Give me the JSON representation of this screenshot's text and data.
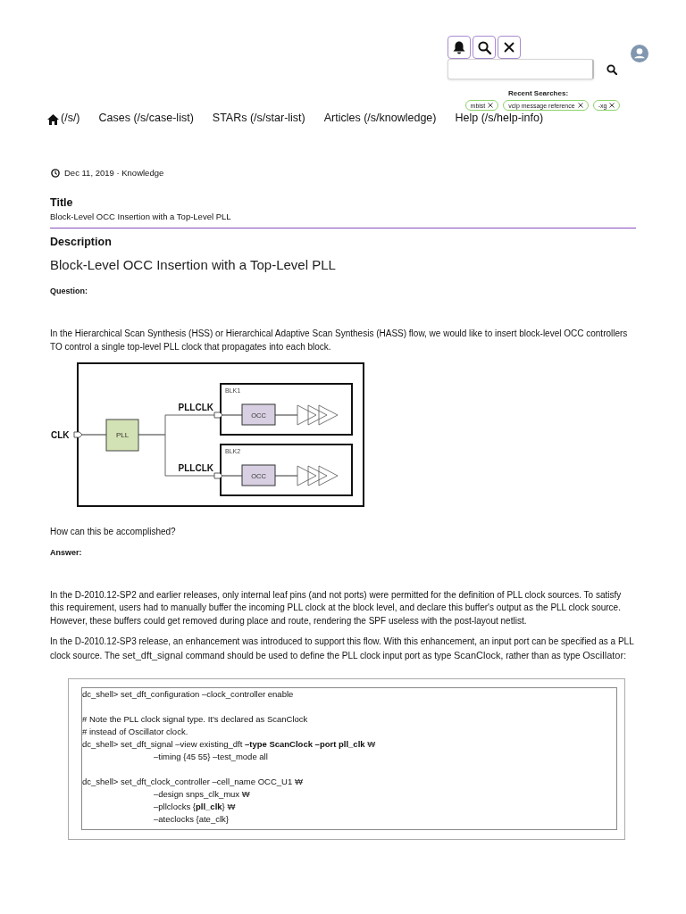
{
  "header": {
    "recent_searches": {
      "label": "Recent Searches:",
      "chips": [
        "mbist",
        "vclp message reference",
        "-xg"
      ]
    }
  },
  "nav": [
    {
      "kind": "home",
      "label": "(/s/)"
    },
    {
      "kind": "link",
      "label": "Cases (/s/case-list)"
    },
    {
      "kind": "link",
      "label": "STARs (/s/star-list)"
    },
    {
      "kind": "link",
      "label": "Articles (/s/knowledge)"
    },
    {
      "kind": "link",
      "label": "Help (/s/help-info)"
    }
  ],
  "meta": "Dec 11, 2019 · Knowledge",
  "title_section": {
    "heading": "Title",
    "value": "Block-Level OCC Insertion with a Top-Level PLL"
  },
  "description": {
    "heading": "Description",
    "article_title": "Block-Level OCC Insertion with a Top-Level PLL",
    "blocks": [
      {
        "kind": "label",
        "text": "Question:"
      },
      {
        "kind": "paragraph",
        "segments": [
          {
            "kind": "text",
            "text": "In the Hierarchical Scan Synthesis (HSS) or Hierarchical Adaptive Scan Synthesis (HASS) flow, we would like to insert block-level OCC controllers TO control a single top-level PLL clock that propagates into each block."
          }
        ]
      },
      {
        "kind": "diagram",
        "input_label": "CLK",
        "pll_label": "PLL",
        "blocks": [
          {
            "name": "BLK1",
            "port_label": "PLLCLK",
            "controller_label": "OCC"
          },
          {
            "name": "BLK2",
            "port_label": "PLLCLK",
            "controller_label": "OCC"
          }
        ]
      },
      {
        "kind": "paragraph",
        "segments": [
          {
            "kind": "text",
            "text": "How can this be accomplished?"
          }
        ]
      },
      {
        "kind": "label",
        "text": "Answer:"
      },
      {
        "kind": "paragraph",
        "segments": [
          {
            "kind": "text",
            "text": "In the D-2010.12-SP2 and earlier releases, only internal leaf pins (and not ports) were permitted for the definition of PLL clock sources. To satisfy this requirement, users had to manually buffer the incoming PLL clock at the block level, and declare this buffer's output as the PLL clock source. However, these buffers could get removed during place and route, rendering the SPF useless with the post-layout netlist."
          }
        ]
      },
      {
        "kind": "paragraph",
        "segments": [
          {
            "kind": "text",
            "text": "In the D-2010.12-SP3 release, an enhancement was introduced to support this flow. With this enhancement, an input port can be specified as a PLL clock source. The "
          },
          {
            "kind": "code",
            "text": "set_dft_signal"
          },
          {
            "kind": "text",
            "text": " command should be used to define the PLL clock input port as type "
          },
          {
            "kind": "code",
            "text": "ScanClock"
          },
          {
            "kind": "text",
            "text": ", rather than as type "
          },
          {
            "kind": "code",
            "text": "Oscillator"
          },
          {
            "kind": "text",
            "text": ":"
          }
        ]
      },
      {
        "kind": "code",
        "groups": [
          [
            {
              "text": "dc_shell> set_dft_configuration –clock_controller enable",
              "indented": false
            }
          ],
          [
            {
              "text": "# Note the PLL clock signal type. It's declared as ScanClock",
              "indented": false
            },
            {
              "text": "# instead of Oscillator clock.",
              "indented": false
            },
            {
              "text": "dc_shell> set_dft_signal –view existing_dft **–type ScanClock –port pll_clk** ₩",
              "indented": false
            },
            {
              "text": "–timing {45 55} –test_mode all",
              "indented": true
            }
          ],
          [
            {
              "text": "dc_shell> set_dft_clock_controller –cell_name OCC_U1 ₩",
              "indented": false
            },
            {
              "text": "–design snps_clk_mux ₩",
              "indented": true
            },
            {
              "text": "–pllclocks {**pll_clk**} ₩",
              "indented": true
            },
            {
              "text": "–ateclocks {ate_clk}",
              "indented": true
            }
          ]
        ]
      }
    ]
  }
}
